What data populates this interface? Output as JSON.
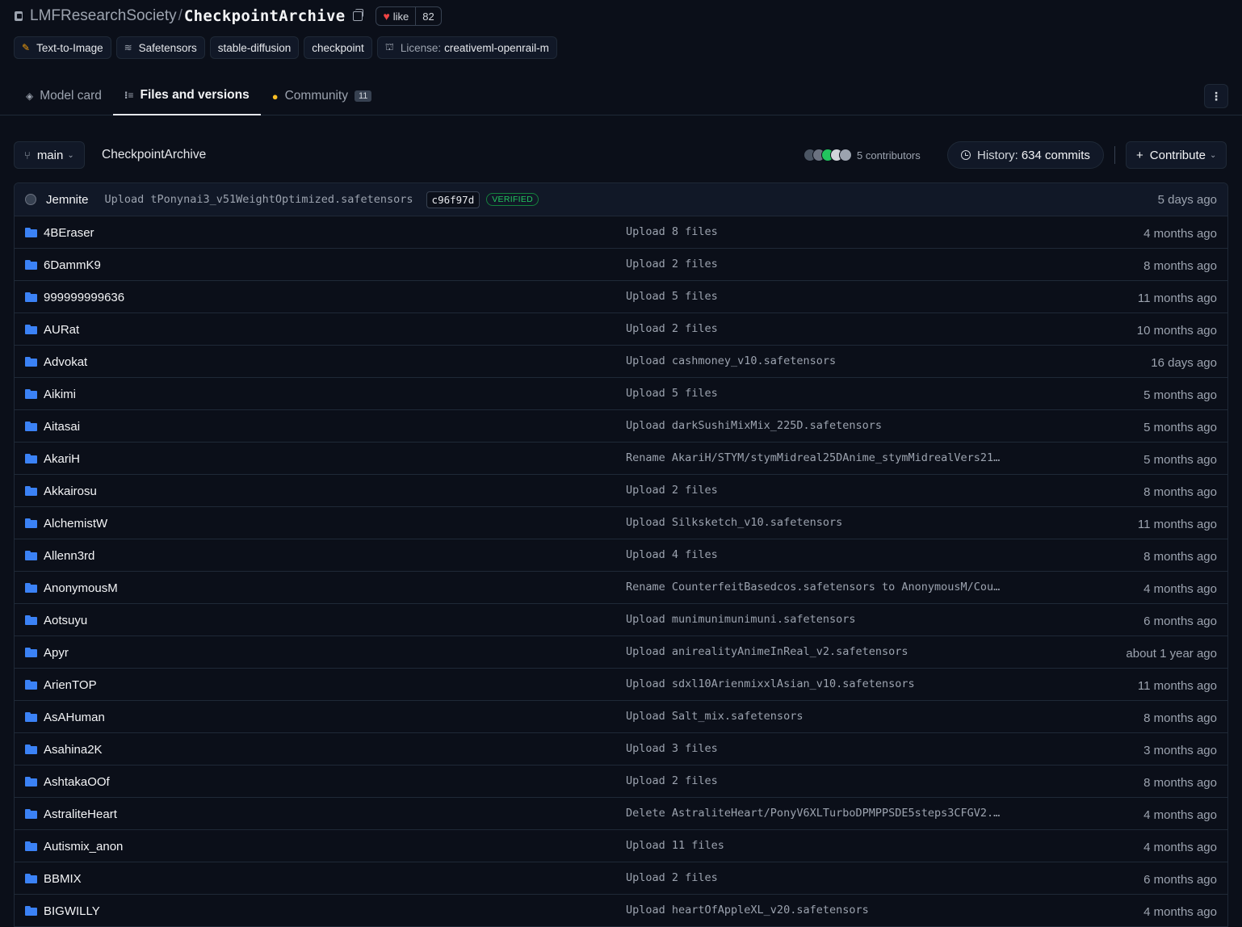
{
  "repo": {
    "org": "LMFResearchSociety",
    "separator": "/",
    "name": "CheckpointArchive",
    "like_label": "like",
    "like_count": "82"
  },
  "tags": [
    {
      "icon": "text-to-image-icon",
      "label": "Text-to-Image"
    },
    {
      "icon": "safetensors-icon",
      "label": "Safetensors"
    },
    {
      "icon": "",
      "label": "stable-diffusion"
    },
    {
      "icon": "",
      "label": "checkpoint"
    },
    {
      "icon": "license-icon",
      "prefix": "License:",
      "label": "creativeml-openrail-m"
    }
  ],
  "tabs": {
    "model_card": "Model card",
    "files": "Files and versions",
    "community": "Community",
    "community_count": "11"
  },
  "branch": {
    "name": "main",
    "path": "CheckpointArchive",
    "contributors": "5 contributors",
    "history_prefix": "History:",
    "history_commits": "634 commits",
    "contribute": "Contribute"
  },
  "colors": {
    "background": "#0b0f19",
    "folder": "#3b82f6",
    "verified": "#22c55e",
    "avatars": [
      "#4b5563",
      "#6b7280",
      "#22c55e",
      "#d1d5db",
      "#9ca3af"
    ]
  },
  "last_commit": {
    "author": "Jemnite",
    "message": "Upload tPonynai3_v51WeightOptimized.safetensors",
    "hash": "c96f97d",
    "badge": "VERIFIED",
    "date": "5 days ago"
  },
  "files": [
    {
      "name": "4BEraser",
      "message": "Upload 8 files",
      "date": "4 months ago"
    },
    {
      "name": "6DammK9",
      "message": "Upload 2 files",
      "date": "8 months ago"
    },
    {
      "name": "999999999636",
      "message": "Upload 5 files",
      "date": "11 months ago"
    },
    {
      "name": "AURat",
      "message": "Upload 2 files",
      "date": "10 months ago"
    },
    {
      "name": "Advokat",
      "message": "Upload cashmoney_v10.safetensors",
      "date": "16 days ago"
    },
    {
      "name": "Aikimi",
      "message": "Upload 5 files",
      "date": "5 months ago"
    },
    {
      "name": "Aitasai",
      "message": "Upload darkSushiMixMix_225D.safetensors",
      "date": "5 months ago"
    },
    {
      "name": "AkariH",
      "message": "Rename AkariH/STYM/stymMidreal25DAnime_stymMidrealVers21…",
      "date": "5 months ago"
    },
    {
      "name": "Akkairosu",
      "message": "Upload 2 files",
      "date": "8 months ago"
    },
    {
      "name": "AlchemistW",
      "message": "Upload Silksketch_v10.safetensors",
      "date": "11 months ago"
    },
    {
      "name": "Allenn3rd",
      "message": "Upload 4 files",
      "date": "8 months ago"
    },
    {
      "name": "AnonymousM",
      "message": "Rename CounterfeitBasedcos.safetensors to AnonymousM/Cou…",
      "date": "4 months ago"
    },
    {
      "name": "Aotsuyu",
      "message": "Upload munimunimunimuni.safetensors",
      "date": "6 months ago"
    },
    {
      "name": "Apyr",
      "message": "Upload anirealityAnimeInReal_v2.safetensors",
      "date": "about 1 year ago"
    },
    {
      "name": "ArienTOP",
      "message": "Upload sdxl10ArienmixxlAsian_v10.safetensors",
      "date": "11 months ago"
    },
    {
      "name": "AsAHuman",
      "message": "Upload Salt_mix.safetensors",
      "date": "8 months ago"
    },
    {
      "name": "Asahina2K",
      "message": "Upload 3 files",
      "date": "3 months ago"
    },
    {
      "name": "AshtakaOOf",
      "message": "Upload 2 files",
      "date": "8 months ago"
    },
    {
      "name": "AstraliteHeart",
      "message": "Delete AstraliteHeart/PonyV6XLTurboDPMPPSDE5steps3CFGV2.…",
      "date": "4 months ago"
    },
    {
      "name": "Autismix_anon",
      "message": "Upload 11 files",
      "date": "4 months ago"
    },
    {
      "name": "BBMIX",
      "message": "Upload 2 files",
      "date": "6 months ago"
    },
    {
      "name": "BIGWILLY",
      "message": "Upload heartOfAppleXL_v20.safetensors",
      "date": "4 months ago"
    }
  ]
}
